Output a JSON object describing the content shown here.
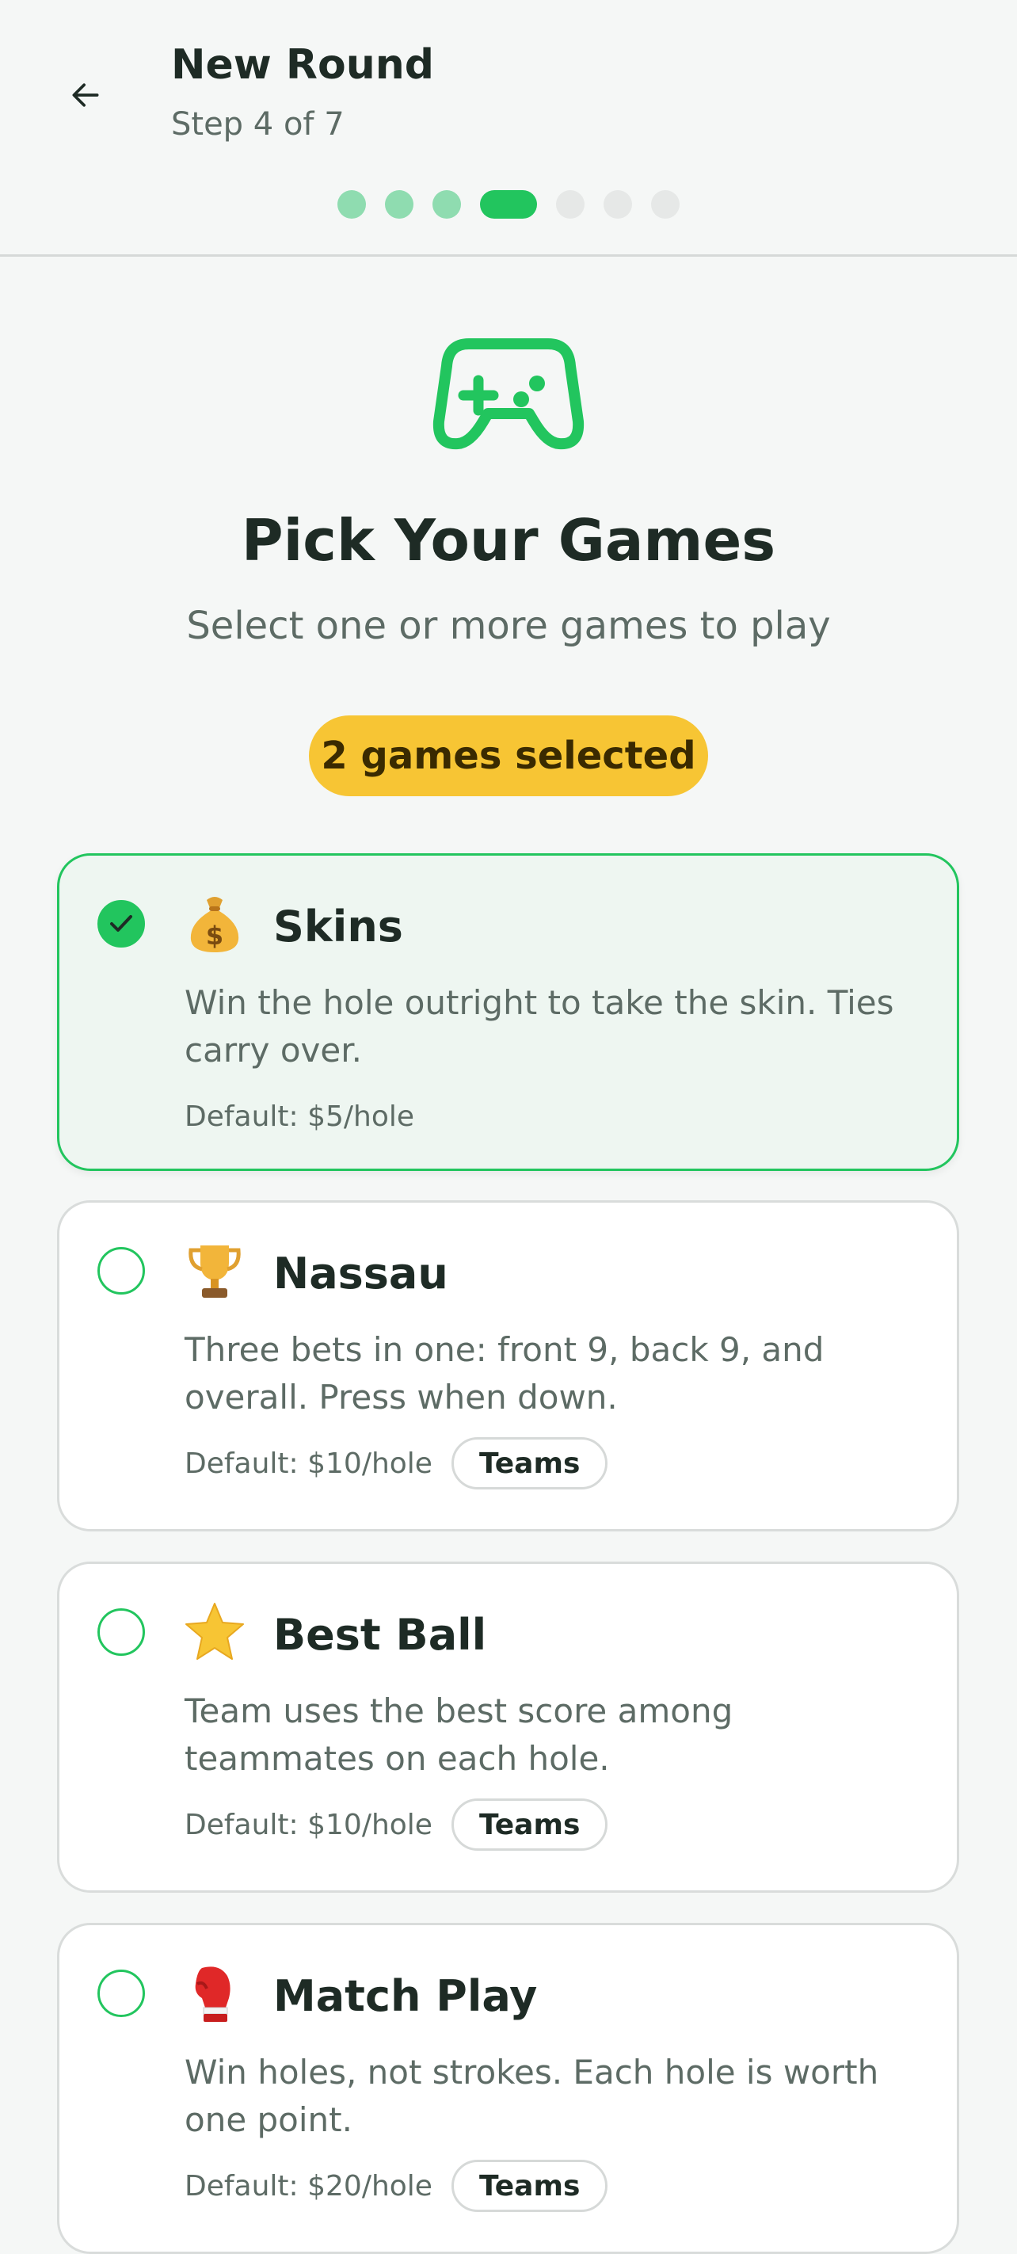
{
  "header": {
    "title": "New Round",
    "step_text": "Step 4 of 7",
    "back_icon": "arrow-left-icon",
    "stepper": {
      "total": 7,
      "current": 4
    }
  },
  "main": {
    "hero_icon": "gamepad-icon",
    "title": "Pick Your Games",
    "subtitle": "Select one or more games to play",
    "selected_badge": "2 games selected"
  },
  "games": [
    {
      "name": "Skins",
      "icon": "money-bag-icon",
      "emoji": "💰",
      "selected": true,
      "description": "Win the hole outright to take the skin. Ties carry over.",
      "default": "Default: $5/hole",
      "tag": ""
    },
    {
      "name": "Nassau",
      "icon": "trophy-icon",
      "emoji": "🏆",
      "selected": false,
      "description": "Three bets in one: front 9, back 9, and overall. Press when down.",
      "default": "Default: $10/hole",
      "tag": "Teams"
    },
    {
      "name": "Best Ball",
      "icon": "star-icon",
      "emoji": "⭐",
      "selected": false,
      "description": "Team uses the best score among teammates on each hole.",
      "default": "Default: $10/hole",
      "tag": "Teams"
    },
    {
      "name": "Match Play",
      "icon": "boxing-glove-icon",
      "emoji": "🥊",
      "selected": false,
      "description": "Win holes, not strokes. Each hole is worth one point.",
      "default": "Default: $20/hole",
      "tag": "Teams"
    }
  ],
  "colors": {
    "accent": "#22c55e",
    "badge": "#f7c534",
    "selected_card_bg": "#eef6f1"
  }
}
